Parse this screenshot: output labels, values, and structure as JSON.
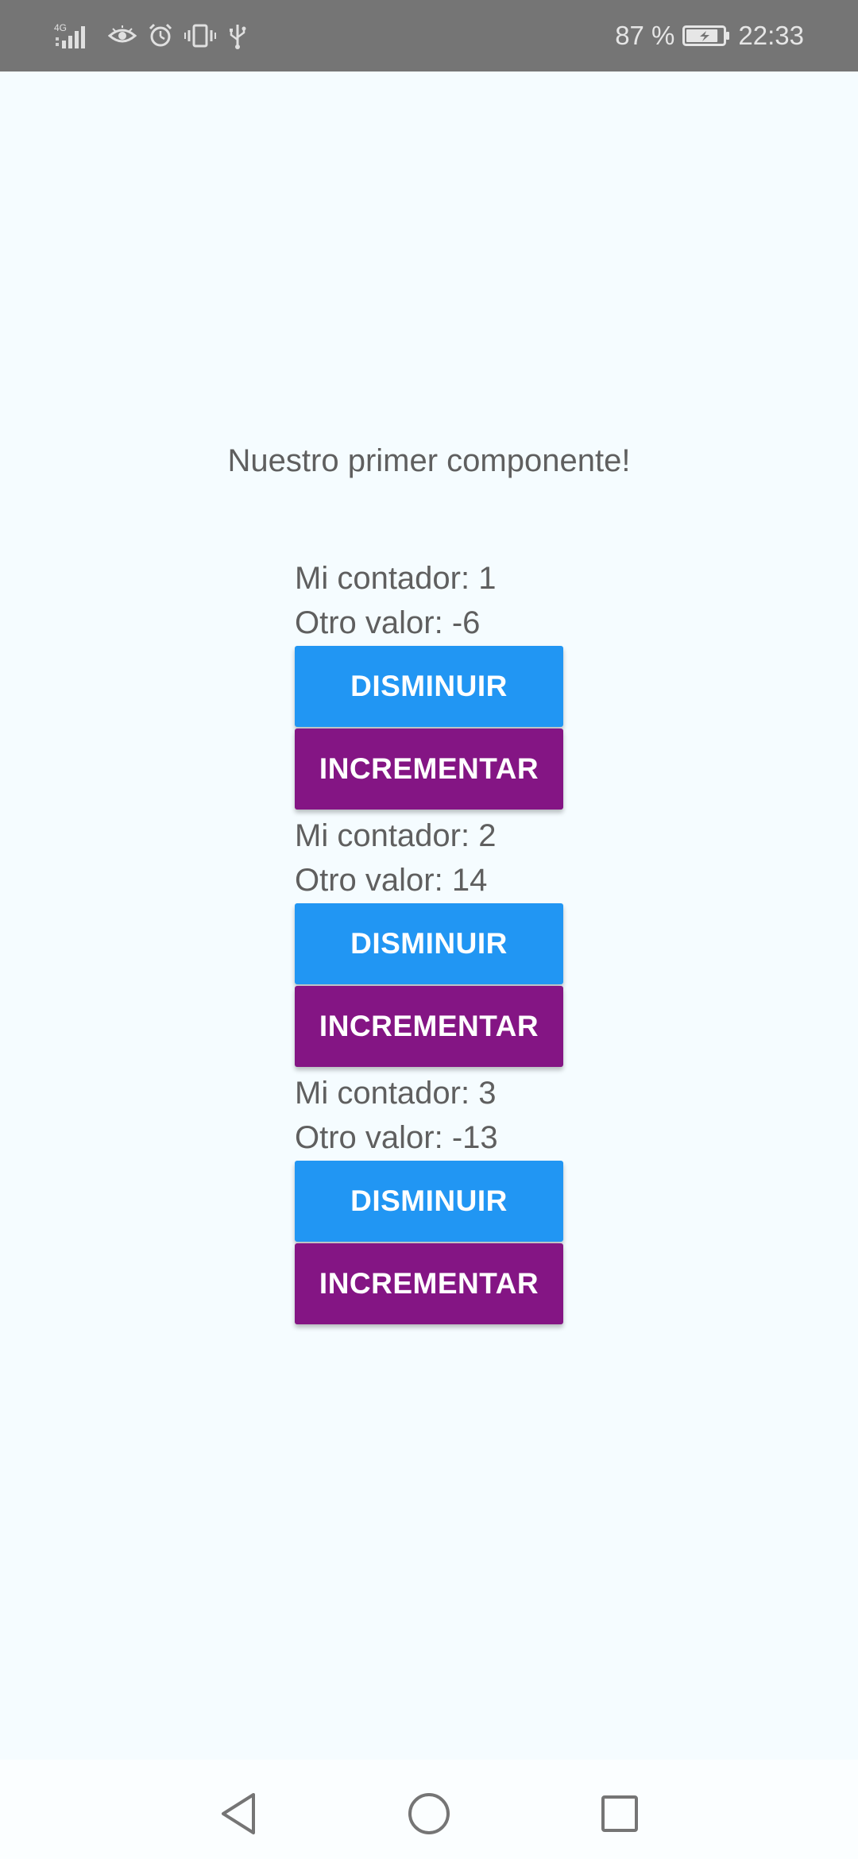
{
  "status_bar": {
    "network_label": "4G",
    "battery_percent": "87 %",
    "battery_level": 0.87,
    "time": "22:33",
    "icons": [
      "signal-icon",
      "eye-icon",
      "alarm-icon",
      "vibrate-icon",
      "usb-icon",
      "battery-icon"
    ]
  },
  "main": {
    "title": "Nuestro primer componente!",
    "counters": [
      {
        "contador_label": "Mi contador: 1",
        "otro_label": "Otro valor: -6",
        "decrease_label": "DISMINUIR",
        "increase_label": "INCREMENTAR"
      },
      {
        "contador_label": "Mi contador: 2",
        "otro_label": "Otro valor: 14",
        "decrease_label": "DISMINUIR",
        "increase_label": "INCREMENTAR"
      },
      {
        "contador_label": "Mi contador: 3",
        "otro_label": "Otro valor: -13",
        "decrease_label": "DISMINUIR",
        "increase_label": "INCREMENTAR"
      }
    ]
  },
  "colors": {
    "background": "#f5fcff",
    "decrease_button": "#2196f3",
    "increase_button": "#841584",
    "text": "#5f5f5f",
    "status_bar": "#757575"
  },
  "nav_bar": {
    "icons": [
      "back-icon",
      "home-icon",
      "recents-icon"
    ]
  }
}
